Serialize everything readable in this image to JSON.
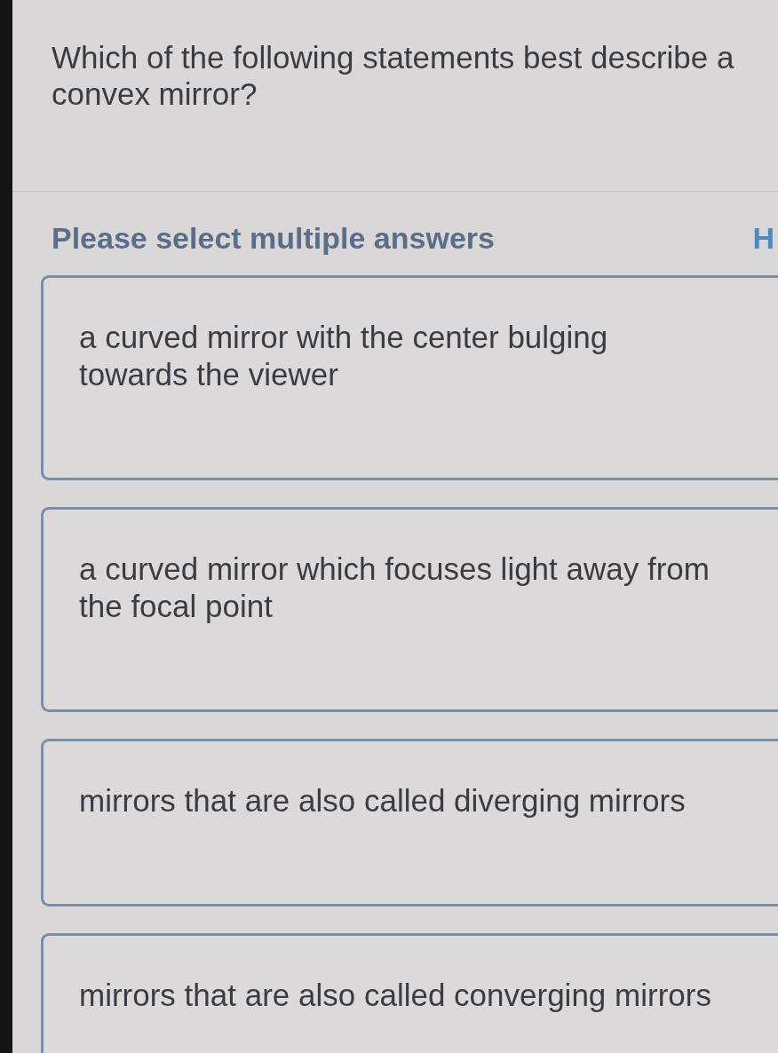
{
  "question": "Which of the following statements best describe a convex mirror?",
  "instruction": "Please select multiple answers",
  "side_link": "H",
  "choices": [
    {
      "text": "a curved mirror with the center bulging towards the viewer",
      "selected": false
    },
    {
      "text": "a curved mirror which focuses light away from the focal point",
      "selected": false
    },
    {
      "text": "mirrors that are also called diverging mirrors",
      "selected": false
    },
    {
      "text": "mirrors that are also called converging mirrors",
      "selected": false
    }
  ]
}
